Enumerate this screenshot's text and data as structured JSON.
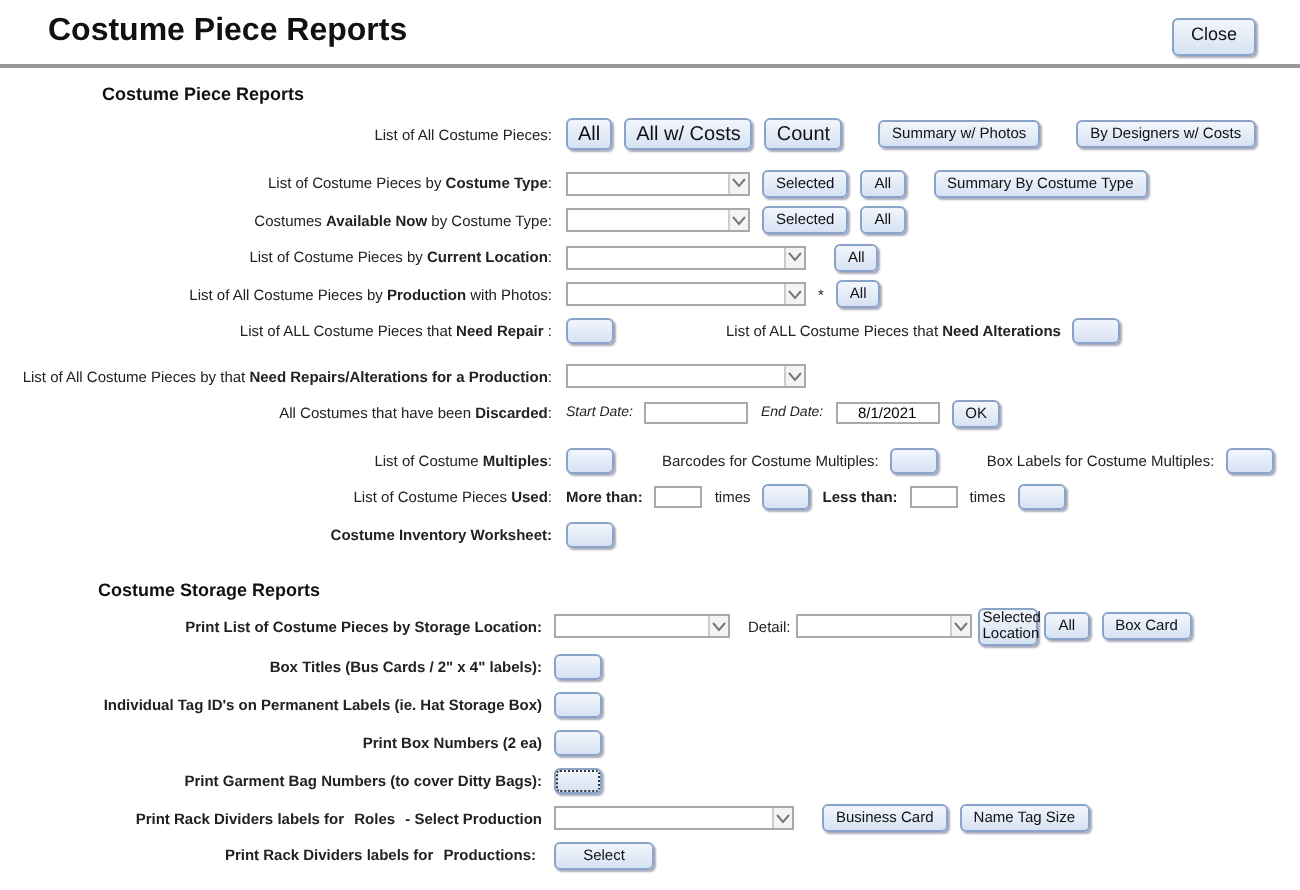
{
  "header": {
    "title": "Costume Piece Reports",
    "close_button": "Close"
  },
  "sections": [
    {
      "title": "Costume Piece Reports",
      "rows": [
        {
          "label": "List of All Costume Pieces:",
          "bold": false,
          "items": [
            {
              "kind": "bigbutton",
              "label": "All"
            },
            {
              "kind": "bigbutton",
              "label": "All w/ Costs"
            },
            {
              "kind": "bigbutton",
              "label": "Count"
            },
            {
              "kind": "button",
              "label": "Summary w/ Photos"
            },
            {
              "kind": "button",
              "label": "By Designers w/ Costs"
            }
          ]
        },
        {
          "label": "List of Costume Pieces by **Costume Type**:",
          "bold": false,
          "items": [
            {
              "kind": "dropdown"
            },
            {
              "kind": "button",
              "label": "Selected"
            },
            {
              "kind": "button",
              "label": "All"
            },
            {
              "kind": "button",
              "label": "Summary By Costume Type"
            }
          ]
        },
        {
          "label": "Costumes  **Available Now**  by Costume Type:",
          "bold": false,
          "items": [
            {
              "kind": "dropdown"
            },
            {
              "kind": "button",
              "label": "Selected"
            },
            {
              "kind": "button",
              "label": "All"
            }
          ]
        },
        {
          "label": "List of Costume Pieces by **Current Location**:",
          "bold": false,
          "items": [
            {
              "kind": "dropdown"
            },
            {
              "kind": "button",
              "label": "All"
            }
          ]
        },
        {
          "label": "List of All Costume Pieces by **Production** with Photos:",
          "bold": false,
          "items": [
            {
              "kind": "dropdown"
            },
            {
              "kind": "text",
              "text": "*"
            },
            {
              "kind": "button",
              "label": "All"
            }
          ]
        },
        {
          "label": "List of ALL Costume Pieces that **Need Repair** :",
          "bold": false,
          "items": [
            {
              "kind": "button"
            },
            {
              "kind": "text",
              "text": "List of ALL Costume Pieces that **Need Alterations**"
            },
            {
              "kind": "button"
            }
          ]
        },
        {
          "label": "List of All Costume Pieces by that **Need Repairs/Alterations for a Production**:",
          "bold": false,
          "items": [
            {
              "kind": "dropdown"
            }
          ]
        },
        {
          "label": "All Costumes that have been  **Discarded**:",
          "bold": false,
          "items": [
            {
              "kind": "field",
              "caption": "Start Date:"
            },
            {
              "kind": "field",
              "caption": "End Date:",
              "value": "8/1/2021"
            },
            {
              "kind": "button",
              "label": "OK"
            }
          ]
        },
        {
          "label": "List of Costume **Multiples**:",
          "bold": false,
          "items": [
            {
              "kind": "button"
            },
            {
              "kind": "text",
              "text": "Barcodes for Costume Multiples:"
            },
            {
              "kind": "button"
            },
            {
              "kind": "text",
              "text": "Box Labels for Costume Multiples:"
            },
            {
              "kind": "button"
            }
          ]
        },
        {
          "label": "List of Costume Pieces **Used**:",
          "bold": false,
          "items": [
            {
              "kind": "caption",
              "text": "More than:"
            },
            {
              "kind": "field"
            },
            {
              "kind": "text",
              "text": "times"
            },
            {
              "kind": "button"
            },
            {
              "kind": "caption",
              "text": "Less than:"
            },
            {
              "kind": "field"
            },
            {
              "kind": "text",
              "text": "times"
            },
            {
              "kind": "button"
            }
          ]
        },
        {
          "label": "Costume Inventory Worksheet:",
          "bold": true,
          "items": [
            {
              "kind": "button"
            }
          ]
        }
      ]
    },
    {
      "title": "Costume Storage Reports",
      "rows": [
        {
          "label": "Print List of Costume Pieces by Storage Location:",
          "bold": true,
          "items": [
            {
              "kind": "dropdown"
            },
            {
              "kind": "text",
              "text": "Detail:"
            },
            {
              "kind": "dropdown"
            },
            {
              "kind": "button",
              "label": "Selected Location"
            },
            {
              "kind": "button",
              "label": "All"
            },
            {
              "kind": "button",
              "label": "Box Card"
            }
          ]
        },
        {
          "label": "Box Titles (Bus Cards / 2\" x 4\" labels):",
          "bold": true,
          "items": [
            {
              "kind": "button"
            }
          ]
        },
        {
          "label": "Individual Tag ID's on Permanent Labels (ie. Hat Storage Box)",
          "bold": true,
          "items": [
            {
              "kind": "button"
            }
          ]
        },
        {
          "label": "Print Box Numbers (2 ea)",
          "bold": true,
          "items": [
            {
              "kind": "button"
            }
          ]
        },
        {
          "label": "Print Garment Bag Numbers (to cover Ditty Bags):",
          "bold": true,
          "items": [
            {
              "kind": "button",
              "focused": true
            }
          ]
        },
        {
          "label": "Print Rack Dividers labels for  **Roles**  -  Select Production",
          "bold": true,
          "items": [
            {
              "kind": "dropdown"
            },
            {
              "kind": "button",
              "label": "Business Card"
            },
            {
              "kind": "button",
              "label": "Name Tag Size"
            }
          ]
        },
        {
          "label": "Print Rack Dividers labels for  **Productions:**",
          "bold": true,
          "items": [
            {
              "kind": "button",
              "label": "Select"
            }
          ]
        }
      ]
    }
  ]
}
